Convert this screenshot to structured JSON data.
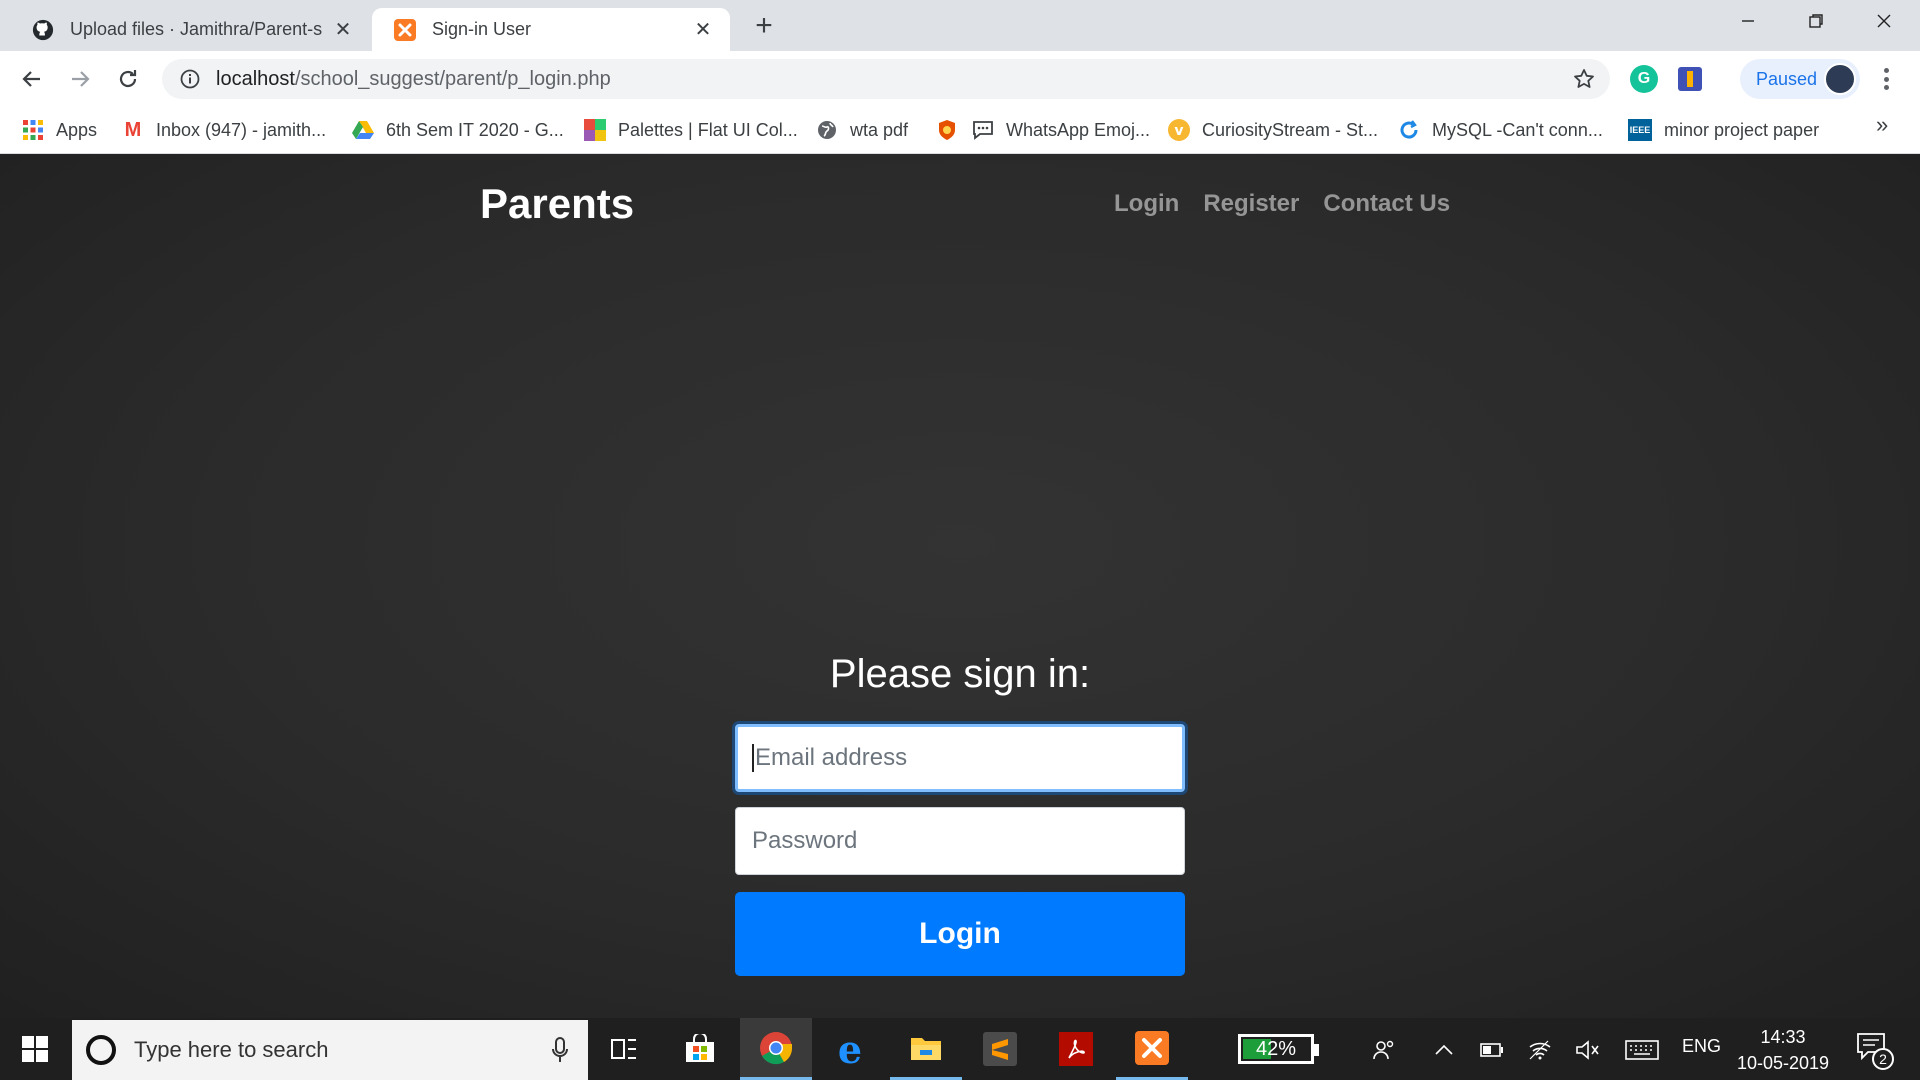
{
  "browser": {
    "tabs": [
      {
        "title": "Upload files · Jamithra/Parent-school",
        "favicon": "github-icon",
        "active": false
      },
      {
        "title": "Sign-in User",
        "favicon": "xampp-icon",
        "active": true
      }
    ],
    "url_host": "localhost",
    "url_path": "/school_suggest/parent/p_login.php",
    "profile_label": "Paused",
    "bookmarks": [
      {
        "label": "Apps",
        "icon": "apps-grid-icon"
      },
      {
        "label": "Inbox (947) - jamith...",
        "icon": "gmail-icon"
      },
      {
        "label": "6th Sem IT 2020 - G...",
        "icon": "drive-icon"
      },
      {
        "label": "Palettes | Flat UI Col...",
        "icon": "palette-icon"
      },
      {
        "label": "wta pdf",
        "icon": "globe-icon"
      },
      {
        "label": "",
        "icon": "shield-bookmark-icon"
      },
      {
        "label": "WhatsApp Emoj...",
        "icon": "chat-bubble-icon"
      },
      {
        "label": "CuriosityStream - St...",
        "icon": "bulb-icon"
      },
      {
        "label": "MySQL -Can't conn...",
        "icon": "refresh-blue-icon"
      },
      {
        "label": "minor project paper",
        "icon": "ieee-icon"
      }
    ]
  },
  "page": {
    "brand": "Parents",
    "nav": [
      "Login",
      "Register",
      "Contact Us"
    ],
    "heading": "Please sign in:",
    "email_placeholder": "Email address",
    "password_placeholder": "Password",
    "login_button": "Login"
  },
  "taskbar": {
    "search_placeholder": "Type here to search",
    "battery": "42%",
    "battery_level": 0.42,
    "language": "ENG",
    "time": "14:33",
    "date": "10-05-2019",
    "notifications": "2"
  },
  "colors": {
    "accent": "#007bff",
    "page_bg": "#2e2e2e",
    "focus_ring": "#80bdff"
  }
}
